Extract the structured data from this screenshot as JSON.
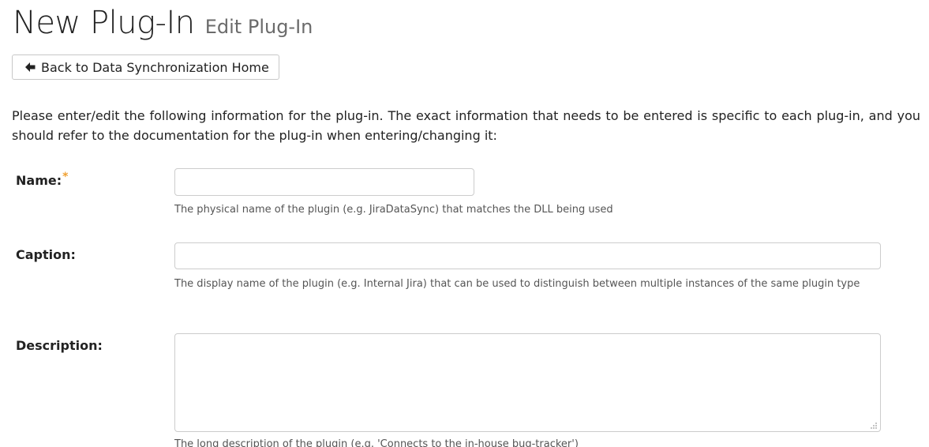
{
  "header": {
    "title": "New Plug-In",
    "subtitle": "Edit Plug-In"
  },
  "back_button": {
    "label": "Back to Data Synchronization Home",
    "icon": "arrow-left-icon"
  },
  "intro": {
    "text": "Please enter/edit the following information for the plug-in. The exact information that needs to be entered is specific to each plug-in, and you should refer to the documentation for the plug-in when entering/changing it:"
  },
  "form": {
    "name": {
      "label": "Name:",
      "required_mark": "*",
      "value": "",
      "help": "The physical name of the plugin (e.g. JiraDataSync) that matches the DLL being used"
    },
    "caption": {
      "label": "Caption:",
      "value": "",
      "help": "The display name of the plugin (e.g. Internal Jira) that can be used to distinguish between multiple instances of the same plugin type"
    },
    "description": {
      "label": "Description:",
      "value": "",
      "help": "The long description of the plugin (e.g. 'Connects to the in-house bug-tracker')"
    }
  },
  "colors": {
    "required_star": "#f0a030",
    "text": "#222222",
    "muted": "#555555",
    "border": "#cccccc"
  }
}
